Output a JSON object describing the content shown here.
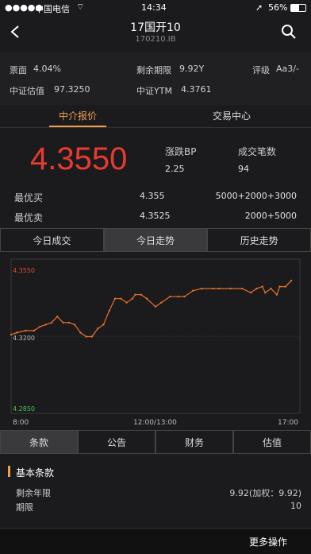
{
  "status": {
    "carrier": "中国电信",
    "time": "14:34",
    "battery": "56%"
  },
  "nav": {
    "title": "17国开10",
    "subtitle": "170210.IB"
  },
  "info": {
    "coupon_label": "票面",
    "coupon": "4.04%",
    "remaining_label": "剩余期限",
    "remaining": "9.92Y",
    "rating_label": "评级",
    "rating": "Aa3/-",
    "cs_value_label": "中证估值",
    "cs_value": "97.3250",
    "cs_ytm_label": "中证YTM",
    "cs_ytm": "4.3761"
  },
  "tabs": [
    "中介报价",
    "交易中心"
  ],
  "quote": {
    "price": "4.3550",
    "change_label": "涨跌BP",
    "change": "2.25",
    "count_label": "成交笔数",
    "count": "94",
    "best_bid_label": "最优买",
    "best_bid": "4.355",
    "best_bid_vol": "5000+2000+3000",
    "best_ask_label": "最优卖",
    "best_ask": "4.3525",
    "best_ask_vol": "2000+5000"
  },
  "segments": [
    "今日成交",
    "今日走势",
    "历史走势"
  ],
  "chart_data": {
    "type": "line",
    "y_labels": [
      "4.3550",
      "4.3200",
      "4.2850"
    ],
    "x_labels": [
      "8:00",
      "12:00/13:00",
      "17:00"
    ],
    "ylim": [
      4.285,
      4.355
    ],
    "x": [
      0,
      0.02,
      0.05,
      0.08,
      0.1,
      0.12,
      0.14,
      0.16,
      0.18,
      0.2,
      0.22,
      0.24,
      0.26,
      0.28,
      0.3,
      0.32,
      0.34,
      0.36,
      0.38,
      0.4,
      0.42,
      0.43,
      0.45,
      0.47,
      0.5,
      0.52,
      0.55,
      0.58,
      0.6,
      0.63,
      0.66,
      0.7,
      0.72,
      0.76,
      0.8,
      0.83,
      0.85,
      0.87,
      0.88,
      0.9,
      0.92,
      0.93,
      0.95,
      0.97
    ],
    "y": [
      4.322,
      4.323,
      4.324,
      4.324,
      4.326,
      4.327,
      4.328,
      4.331,
      4.328,
      4.328,
      4.327,
      4.323,
      4.321,
      4.321,
      4.325,
      4.327,
      4.334,
      4.34,
      4.34,
      4.338,
      4.34,
      4.342,
      4.342,
      4.34,
      4.336,
      4.338,
      4.341,
      4.341,
      4.341,
      4.344,
      4.345,
      4.345,
      4.345,
      4.345,
      4.345,
      4.343,
      4.345,
      4.346,
      4.343,
      4.345,
      4.342,
      4.346,
      4.346,
      4.349
    ],
    "color": "#e8702a"
  },
  "bottom_tabs": [
    "条款",
    "公告",
    "财务",
    "估值"
  ],
  "terms": {
    "title": "基本条款",
    "r1_label": "剩余年限",
    "r1_value": "9.92(加权：9.92)",
    "r2_label": "期限",
    "r2_value": "10"
  },
  "more": "更多操作"
}
